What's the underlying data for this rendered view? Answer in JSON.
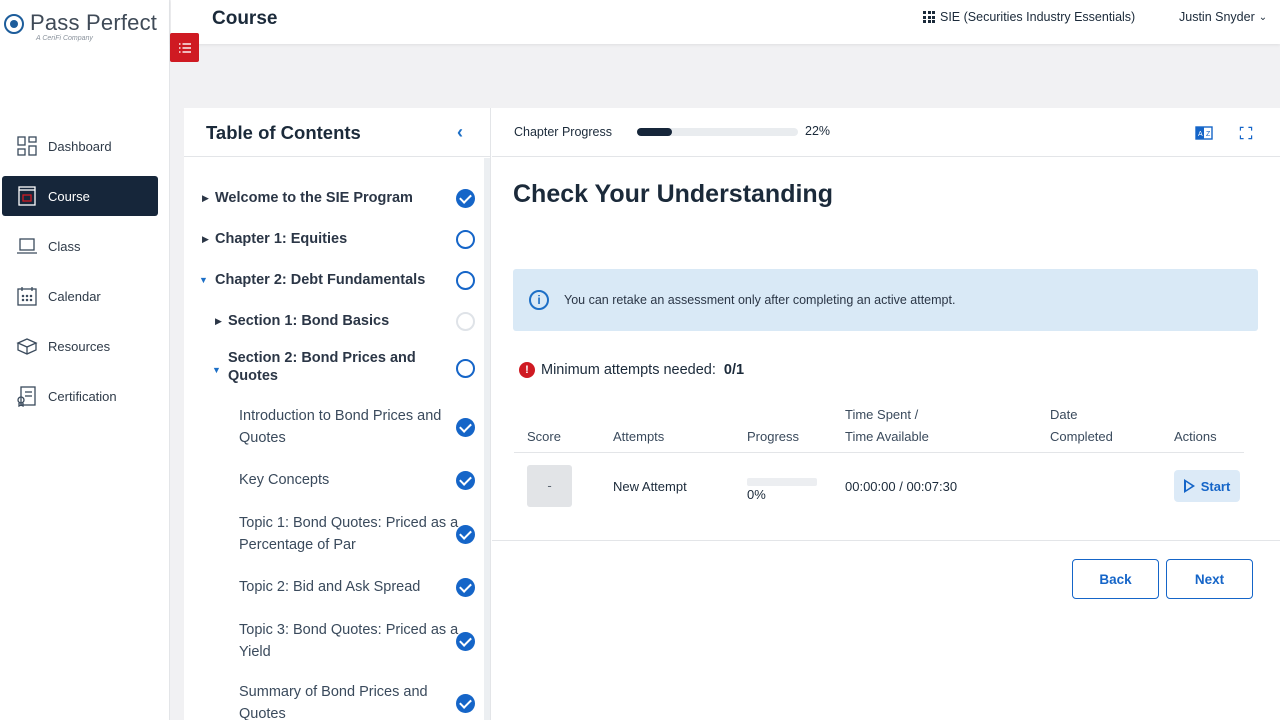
{
  "brand": {
    "name": "Pass Perfect",
    "tagline": "A CeriFi Company"
  },
  "sidebar": {
    "items": [
      {
        "label": "Dashboard",
        "icon": "dashboard-icon",
        "active": false
      },
      {
        "label": "Course",
        "icon": "book-icon",
        "active": true
      },
      {
        "label": "Class",
        "icon": "laptop-icon",
        "active": false
      },
      {
        "label": "Calendar",
        "icon": "calendar-icon",
        "active": false
      },
      {
        "label": "Resources",
        "icon": "box-icon",
        "active": false
      },
      {
        "label": "Certification",
        "icon": "certificate-icon",
        "active": false
      }
    ]
  },
  "header": {
    "title": "Course",
    "course_selector": "SIE (Securities Industry Essentials)",
    "user": "Justin Snyder"
  },
  "toc": {
    "title": "Table of Contents",
    "items": [
      {
        "label": "Welcome to the SIE Program",
        "status": "complete"
      },
      {
        "label": "Chapter 1: Equities",
        "status": "in-progress"
      },
      {
        "label": "Chapter 2: Debt Fundamentals",
        "status": "in-progress"
      },
      {
        "label": "Section 1: Bond Basics",
        "status": "not-started"
      },
      {
        "label": "Section 2: Bond Prices and Quotes",
        "status": "in-progress"
      },
      {
        "label": "Introduction to Bond Prices and Quotes",
        "status": "complete"
      },
      {
        "label": "Key Concepts",
        "status": "complete"
      },
      {
        "label": "Topic 1: Bond Quotes: Priced as a Percentage of Par",
        "status": "complete"
      },
      {
        "label": "Topic 2: Bid and Ask Spread",
        "status": "complete"
      },
      {
        "label": "Topic 3: Bond Quotes: Priced as a Yield",
        "status": "complete"
      },
      {
        "label": "Summary of Bond Prices and Quotes",
        "status": "complete"
      }
    ]
  },
  "chapter_progress": {
    "label": "Chapter Progress",
    "value": 22,
    "display": "22%"
  },
  "main": {
    "heading": "Check Your Understanding",
    "info_message": "You can retake an assessment only after completing an active attempt.",
    "min_attempts_label": "Minimum attempts needed:",
    "min_attempts_value": "0/1"
  },
  "attempts_table": {
    "headers": {
      "score": "Score",
      "attempts": "Attempts",
      "progress": "Progress",
      "time_line1": "Time Spent /",
      "time_line2": "Time Available",
      "date_line1": "Date",
      "date_line2": "Completed",
      "actions": "Actions"
    },
    "row": {
      "score": "-",
      "attempt": "New Attempt",
      "progress": "0%",
      "time": "00:00:00 / 00:07:30",
      "date": "",
      "action": "Start"
    }
  },
  "footer": {
    "back": "Back",
    "next": "Next"
  },
  "colors": {
    "accent": "#1565c8",
    "brand_red": "#cf1a22",
    "nav_active": "#16263a",
    "info_bg": "#d9e9f6"
  }
}
